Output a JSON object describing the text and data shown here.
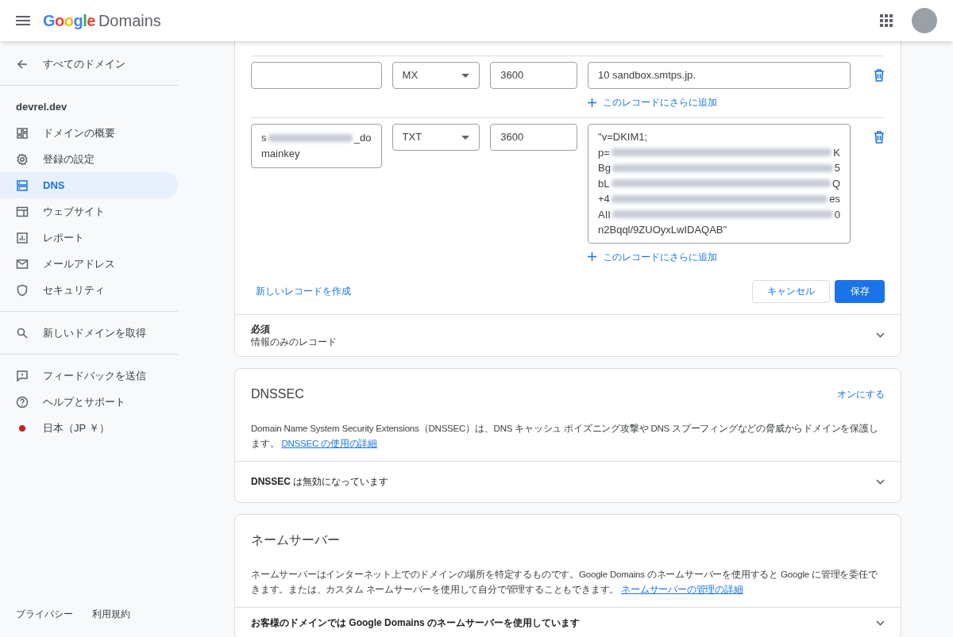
{
  "header": {
    "logo_word": "Google",
    "logo_product": "Domains"
  },
  "sidebar": {
    "back": "すべてのドメイン",
    "domain": "devrel.dev",
    "items": [
      {
        "label": "ドメインの概要",
        "selected": false
      },
      {
        "label": "登録の設定",
        "selected": false
      },
      {
        "label": "DNS",
        "selected": true
      },
      {
        "label": "ウェブサイト",
        "selected": false
      },
      {
        "label": "レポート",
        "selected": false
      },
      {
        "label": "メールアドレス",
        "selected": false
      },
      {
        "label": "セキュリティ",
        "selected": false
      }
    ],
    "search_item": "新しいドメインを取得",
    "help_items": [
      "フィードバックを送信",
      "ヘルプとサポート",
      "日本（JP ￥）"
    ],
    "footer_links": [
      "プライバシー",
      "利用規約"
    ]
  },
  "records": {
    "rows": [
      {
        "host_lines": [],
        "type": "MX",
        "ttl": "3600",
        "data_lines": [
          {
            "start": "10 sandbox.smtps.jp.",
            "blurred": false
          }
        ],
        "add_link": "このレコードにさらに追加"
      },
      {
        "host_lines": [
          {
            "start": "s",
            "end": "_do",
            "blurred": true
          },
          {
            "start": "mainkey",
            "blurred": false
          }
        ],
        "type": "TXT",
        "ttl": "3600",
        "data_lines": [
          {
            "start": "\"v=DKIM1;",
            "blurred": false
          },
          {
            "start": "p=",
            "end": "K",
            "blurred": true
          },
          {
            "start": "Bg",
            "end": "5",
            "blurred": true
          },
          {
            "start": "bL",
            "end": "Q",
            "blurred": true
          },
          {
            "start": "+4",
            "end": "es",
            "blurred": true
          },
          {
            "start": "AII",
            "end": "0",
            "blurred": true
          },
          {
            "start": "n2Bqql/9ZUOyxLwIDAQAB\"",
            "blurred": false
          }
        ],
        "add_link": "このレコードにさらに追加"
      }
    ],
    "new_record_link": "新しいレコードを作成",
    "cancel": "キャンセル",
    "save": "保存",
    "collapsed": {
      "title": "必須",
      "subtitle": "情報のみのレコード",
      "expanded": false
    }
  },
  "dnssec": {
    "title": "DNSSEC",
    "action": "オンにする",
    "description": "Domain Name System Security Extensions（DNSSEC）は、DNS キャッシュ ポイズニング攻撃や DNS スプーフィングなどの脅威からドメインを保護します。",
    "link": "DNSSEC の使用の詳細",
    "status_bold": "DNSSEC",
    "status_rest": " は無効になっています",
    "expanded": false
  },
  "nameservers": {
    "title": "ネームサーバー",
    "description": "ネームサーバーはインターネット上でのドメインの場所を特定するものです。Google Domains のネームサーバーを使用すると Google に管理を委任できます。または、カスタム ネームサーバーを使用して自分で管理することもできます。",
    "link": "ネームサーバーの管理の詳細",
    "status": "お客様のドメインでは Google Domains のネームサーバーを使用しています",
    "expanded": false
  }
}
